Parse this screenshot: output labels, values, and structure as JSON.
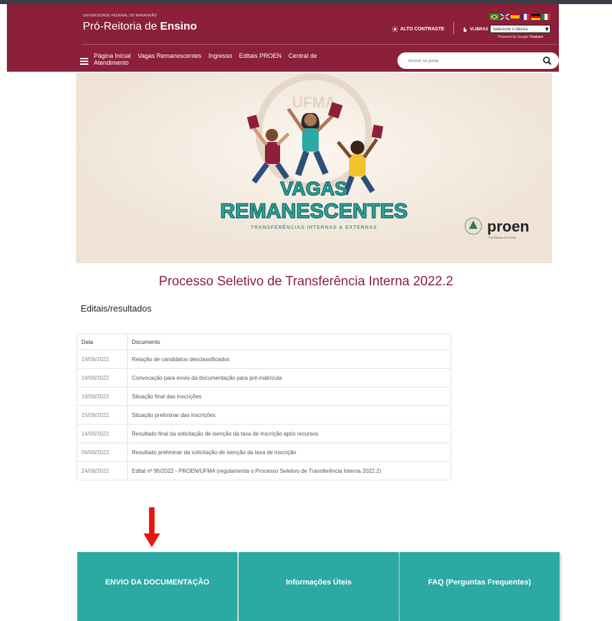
{
  "header": {
    "university": "UNIVERSIDADE FEDERAL DO MARANHÃO",
    "brand_light": "Pró-Reitoria de ",
    "brand_bold": "Ensino",
    "contrast_label": "ALTO CONTRASTE",
    "libras_label": "VLIBRAS",
    "language_select": "Selecione o idioma",
    "powered_by_prefix": "Powered by Google ",
    "powered_by_brand": "Tradutor",
    "nav": [
      {
        "line1": "Página Inicial",
        "line2": "Atendimento"
      },
      {
        "line1": "Vagas Remanescentes",
        "line2": ""
      },
      {
        "line1": "Ingresso",
        "line2": ""
      },
      {
        "line1": "Editais PROEN",
        "line2": ""
      },
      {
        "line1": "Central de",
        "line2": ""
      }
    ],
    "search_placeholder": "Buscar no portal",
    "colors": {
      "header_bg": "#8c1f3a",
      "accent_teal": "#2aaaa2"
    }
  },
  "banner": {
    "watermark": "UFMA",
    "title_line1": "VAGAS",
    "title_line2": "REMANESCENTES",
    "subtitle": "TRANSFERÊNCIAS INTERNAS & EXTERNAS",
    "logo_text": "proen",
    "logo_caption": "Pró-Reitoria de Ensino"
  },
  "page": {
    "title": "Processo Seletivo de Transferência Interna 2022.2",
    "section_heading": "Editais/resultados"
  },
  "table": {
    "headers": [
      "Data",
      "Documento"
    ],
    "rows": [
      {
        "date": "19/09/2022",
        "doc": "Relação de candidatos desclassificados"
      },
      {
        "date": "19/09/2022",
        "doc": "Convocação para envio da documentação para pré-matrícula"
      },
      {
        "date": "19/09/2022",
        "doc": "Situação final das inscrições"
      },
      {
        "date": "15/09/2022",
        "doc": "Situação preliminar das inscrições"
      },
      {
        "date": "14/09/2022",
        "doc": "Resultado final da solicitação de isenção da taxa de inscrição após recursos"
      },
      {
        "date": "06/09/2022",
        "doc": "Resultado preliminar da solicitação de isenção da taxa de inscrição"
      },
      {
        "date": "24/08/2022",
        "doc": "Edital nº 95/2022 - PROEN/UFMA (regulamenta o Processo Seletivo de Transferência Interna 2022.2)"
      }
    ]
  },
  "cards": [
    {
      "label": "ENVIO DA DOCUMENTAÇÃO"
    },
    {
      "label": "Informações Úteis"
    },
    {
      "label": "FAQ (Perguntas Frequentes)"
    }
  ]
}
